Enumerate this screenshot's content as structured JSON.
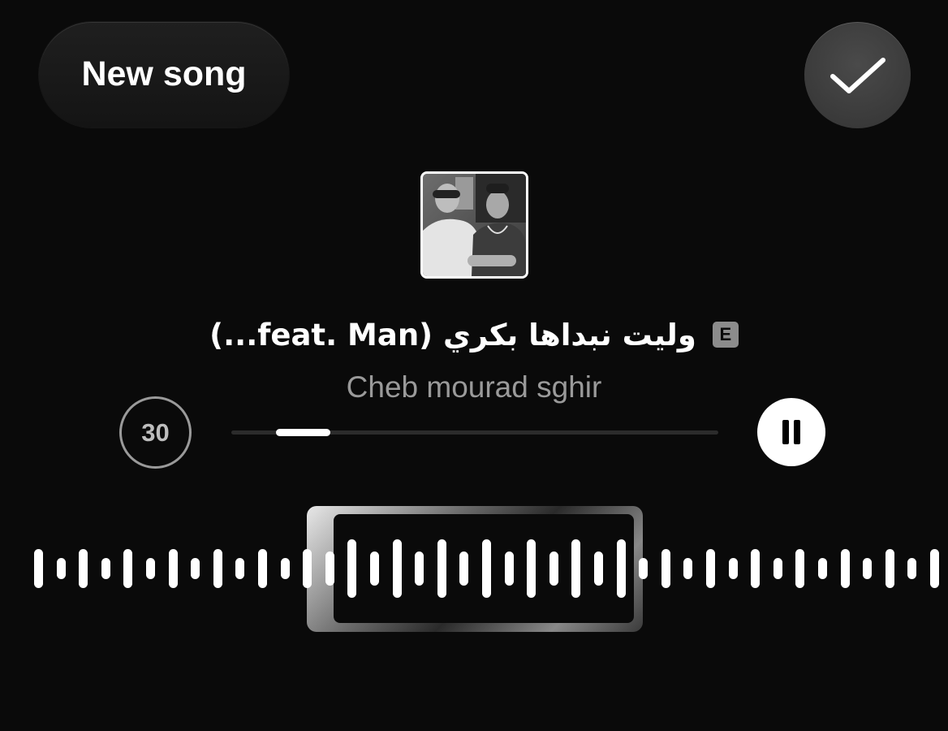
{
  "header": {
    "new_song_label": "New song",
    "confirm_icon": "checkmark-icon"
  },
  "track": {
    "title": "ولیت نبداها بكري (feat. Man...)",
    "explicit_badge": "E",
    "artist": "Cheb mourad sghir",
    "cover_icon": "album-cover"
  },
  "player": {
    "clip_duration": "30",
    "progress_fraction": 0.12,
    "pause_icon": "pause-icon"
  },
  "waveform": {
    "selection_start_fraction": 0.32,
    "selection_end_fraction": 0.68
  }
}
